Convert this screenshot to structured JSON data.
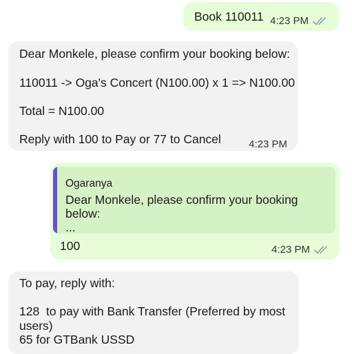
{
  "messages": [
    {
      "direction": "outgoing",
      "text": "Book 110011",
      "time": "4:23 PM",
      "status": "read",
      "status_icon": "double-check-icon"
    },
    {
      "direction": "incoming",
      "lines": [
        "Dear Monkele, please confirm your booking below:",
        "110011 -> Oga's Concert (N100.00) x 1 => N100.00",
        "Total = N100.00",
        "Reply with 100 to Pay or 77 to Cancel"
      ],
      "time": "4:23 PM"
    },
    {
      "direction": "outgoing",
      "quoted": {
        "author": "Ogaranya",
        "text": "Dear Monkele, please confirm your booking below:\n..."
      },
      "text": "100",
      "time": "4:23 PM",
      "status": "read",
      "status_icon": "double-check-icon"
    },
    {
      "direction": "incoming",
      "lines": [
        "To pay, reply with:",
        "128  to pay with Bank Transfer (Preferred by most users)",
        "65 for GTBank USSD"
      ]
    }
  ],
  "colors": {
    "outgoing_bubble": "#e7fdd8",
    "incoming_bubble": "#f2f2f2",
    "quote_background": "#d5f2c4",
    "quote_bar": "#6a4fd0",
    "tick_color": "#8a9aa6"
  }
}
